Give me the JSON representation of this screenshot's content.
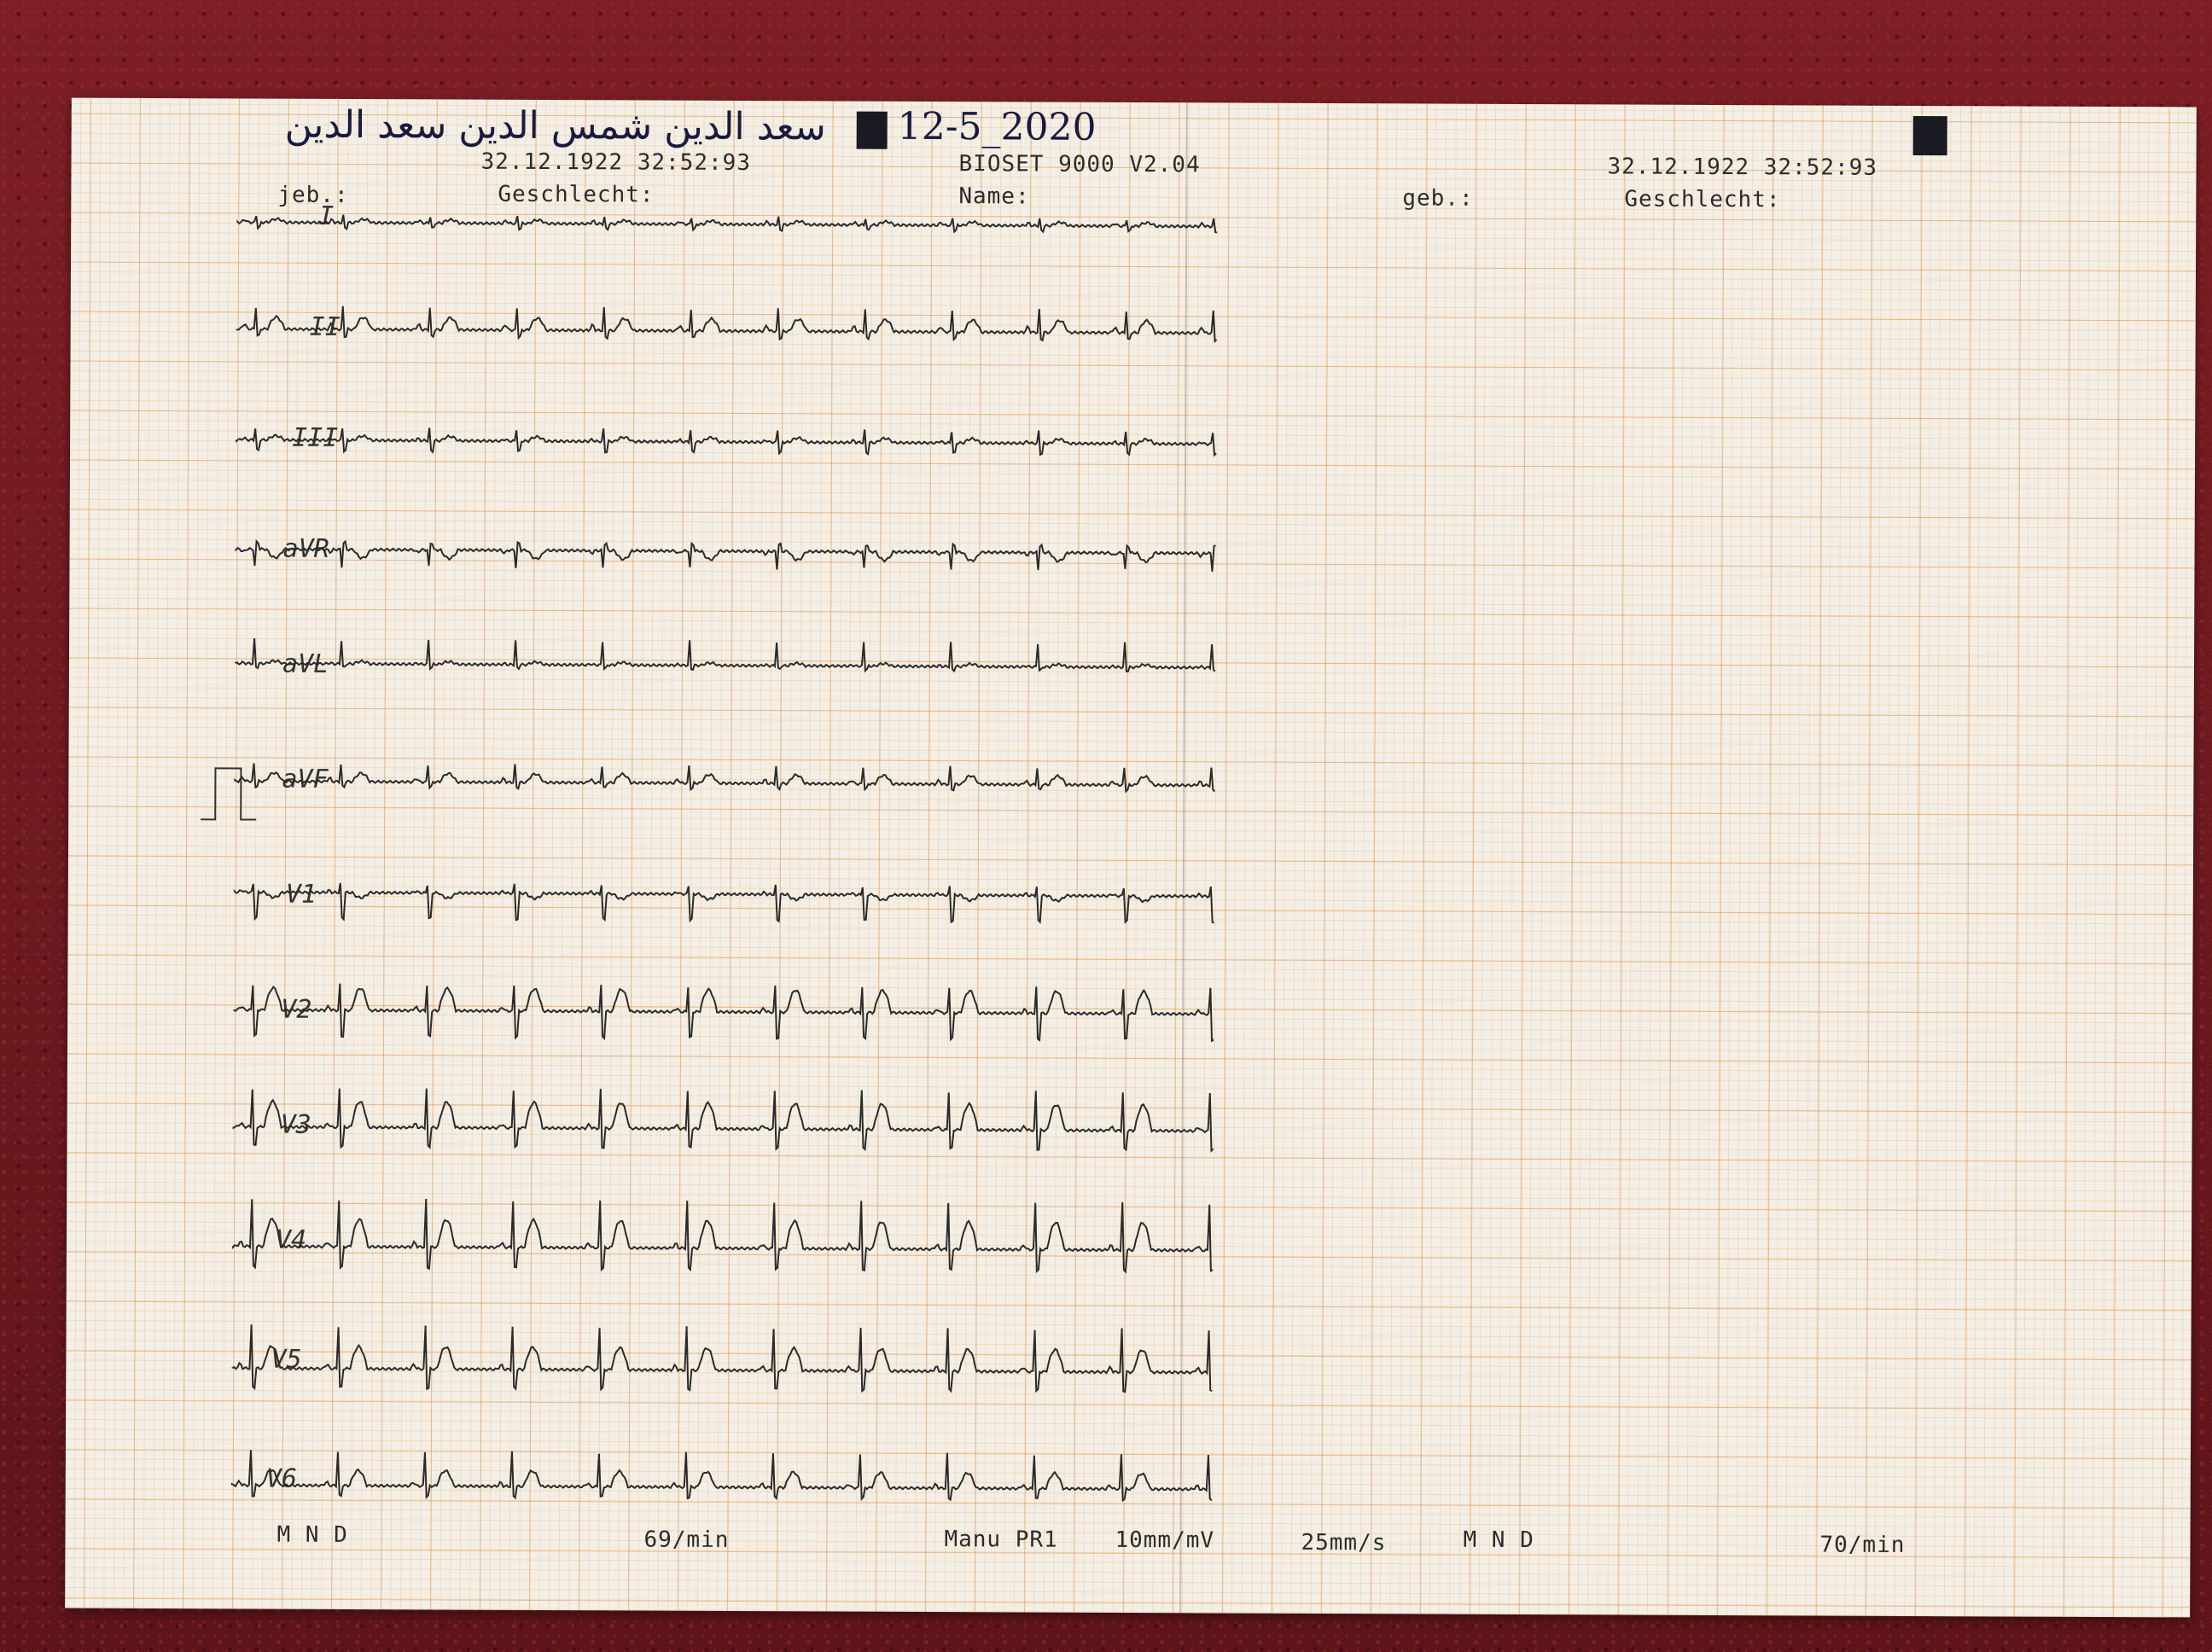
{
  "handwriting": {
    "patient_name": "سعد الدين شمس الدين سعد الدين",
    "date": "12-5_2020"
  },
  "header_left": {
    "datetime": "32.12.1922 32:52:93",
    "geb_label": "jeb.:",
    "geschlecht_label": "Geschlecht:"
  },
  "header_center": {
    "device": "BIOSET 9000 V2.04",
    "name_label": "Name:"
  },
  "header_right": {
    "datetime": "32.12.1922 32:52:93",
    "geb_label": "geb.:",
    "geschlecht_label": "Geschlecht:"
  },
  "leads": [
    "I",
    "II",
    "III",
    "aVR",
    "aVL",
    "aVF",
    "V1",
    "V2",
    "V3",
    "V4",
    "V5",
    "V6"
  ],
  "footer": {
    "filter_left": "M  N  D",
    "rate_left": "69/min",
    "mode": "Manu PR1",
    "gain": "10mm/mV",
    "speed": "25mm/s",
    "filter_right": "M  N  D",
    "rate_right": "70/min"
  },
  "colors": {
    "grid_major": "#e29650",
    "grid_minor": "#ebb478",
    "trace": "#2a2a2a",
    "paper": "#f3efe6",
    "tablecloth": "#6e1a1f"
  }
}
